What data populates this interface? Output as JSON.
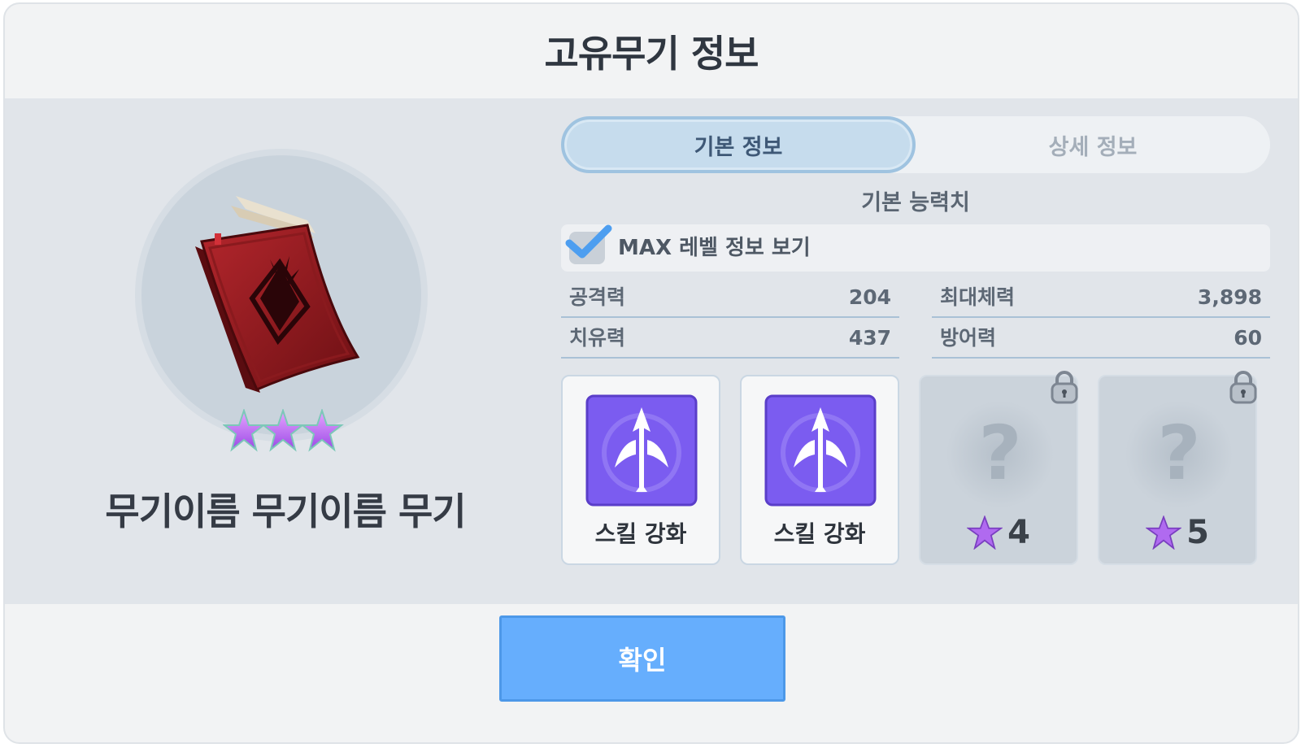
{
  "dialog": {
    "title": "고유무기 정보",
    "confirm_label": "확인"
  },
  "weapon": {
    "name": "무기이름 무기이름 무기",
    "stars": 3,
    "icon": "red-book-icon"
  },
  "tabs": [
    {
      "label": "기본 정보",
      "active": true
    },
    {
      "label": "상세 정보",
      "active": false
    }
  ],
  "stats_section": {
    "title": "기본 능력치",
    "max_toggle_label": "MAX 레벨 정보 보기",
    "max_toggle_checked": true,
    "stats": [
      {
        "label": "공격력",
        "value": "204"
      },
      {
        "label": "최대체력",
        "value": "3,898"
      },
      {
        "label": "치유력",
        "value": "437"
      },
      {
        "label": "방어력",
        "value": "60"
      }
    ]
  },
  "skill_cards": [
    {
      "label": "스킬 강화",
      "locked": false,
      "icon": "arrow-skill-icon"
    },
    {
      "label": "스킬 강화",
      "locked": false,
      "icon": "arrow-skill-icon"
    },
    {
      "star_requirement": "4",
      "locked": true,
      "icon": "question-mark-icon"
    },
    {
      "star_requirement": "5",
      "locked": true,
      "icon": "question-mark-icon"
    }
  ],
  "colors": {
    "accent_blue": "#66aefd",
    "tab_active": "#c6dced",
    "skill_purple": "#7b5cf0",
    "star_purple": "#b06af0"
  }
}
